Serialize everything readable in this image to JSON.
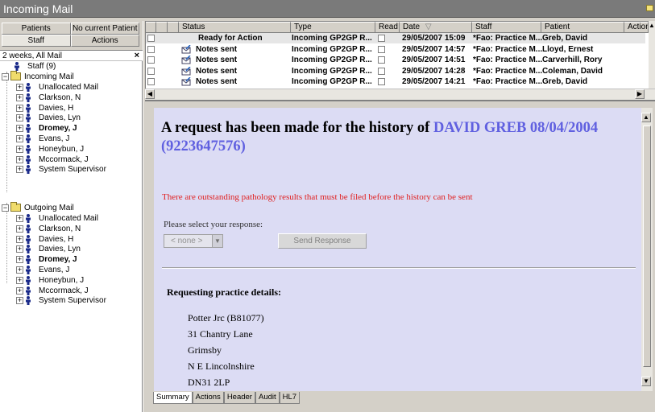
{
  "window": {
    "title": "Incoming Mail"
  },
  "left_tabs": {
    "row1": [
      "Patients",
      "No current Patient"
    ],
    "row2": [
      "Staff",
      "Actions"
    ]
  },
  "filter": {
    "label": "2 weeks, All Mail",
    "close": "×"
  },
  "tree": {
    "staff_root": "Staff (9)",
    "incoming_folder": "Incoming Mail",
    "outgoing_folder": "Outgoing Mail",
    "incoming_items": [
      "Unallocated Mail",
      "Clarkson, N",
      "Davies, H",
      "Davies, Lyn",
      "Dromey, J",
      "Evans, J",
      "Honeybun, J",
      "Mccormack, J",
      "System Supervisor"
    ],
    "outgoing_items": [
      "Unallocated Mail",
      "Clarkson, N",
      "Davies, H",
      "Davies, Lyn",
      "Dromey, J",
      "Evans, J",
      "Honeybun, J",
      "Mccormack, J",
      "System Supervisor"
    ],
    "bold_item": "Dromey, J"
  },
  "grid": {
    "columns": [
      "",
      "",
      "Status",
      "Type",
      "Read",
      "Date",
      "Staff",
      "Patient",
      "Action"
    ],
    "rows": [
      {
        "status": "Ready for Action",
        "type": "Incoming GP2GP R...",
        "date": "29/05/2007 15:09",
        "staff": "*Fao: Practice M...",
        "patient": "Greb, David",
        "icon": "none"
      },
      {
        "status": "Notes sent",
        "type": "Incoming GP2GP R...",
        "date": "29/05/2007 14:57",
        "staff": "*Fao: Practice M...",
        "patient": "Lloyd, Ernest",
        "icon": "mail-sent-icon"
      },
      {
        "status": "Notes sent",
        "type": "Incoming GP2GP R...",
        "date": "29/05/2007 14:51",
        "staff": "*Fao: Practice M...",
        "patient": "Carverhill, Rory",
        "icon": "mail-sent-icon"
      },
      {
        "status": "Notes sent",
        "type": "Incoming GP2GP R...",
        "date": "29/05/2007 14:28",
        "staff": "*Fao: Practice M...",
        "patient": "Coleman, David",
        "icon": "mail-sent-icon"
      },
      {
        "status": "Notes sent",
        "type": "Incoming GP2GP R...",
        "date": "29/05/2007 14:21",
        "staff": "*Fao: Practice M...",
        "patient": "Greb, David",
        "icon": "mail-sent-icon"
      }
    ]
  },
  "detail": {
    "heading_prefix": "A request has been made for the history of ",
    "heading_highlight": "DAVID GREB 08/04/2004 (9223647576)",
    "warning": "There are outstanding pathology results that must be filed before the history can be sent",
    "prompt": "Please select your response:",
    "combo_value": "< none >",
    "send_button": "Send Response",
    "requesting_heading": "Requesting practice details:",
    "address": [
      "Potter Jrc (B81077)",
      "31 Chantry Lane",
      "Grimsby",
      "N E Lincolnshire",
      "DN31 2LP"
    ]
  },
  "bottom_tabs": [
    "Summary",
    "Actions",
    "Header",
    "Audit",
    "HL7"
  ],
  "colors": {
    "highlight": "#6060e0",
    "warning": "#e02020",
    "detail_bg": "#dcdcf4",
    "titlebar": "#7a7a7a"
  }
}
